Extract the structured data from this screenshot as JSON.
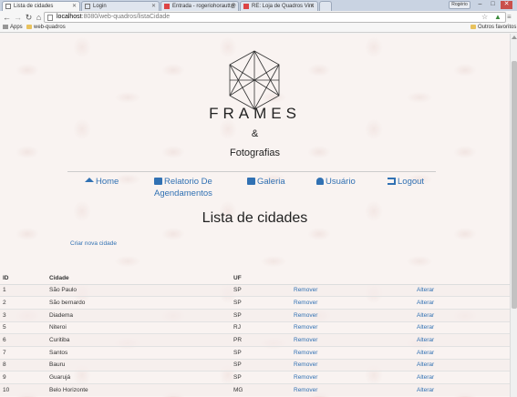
{
  "browser": {
    "tabs": [
      {
        "title": "Lista de cidades",
        "active": true
      },
      {
        "title": "Login",
        "active": false
      },
      {
        "title": "Entrada - rogeriohorautt@",
        "active": false
      },
      {
        "title": "RE: Loja de Quadros Vint",
        "active": false
      }
    ],
    "profile_label": "Rogério",
    "url_host": "localhost",
    "url_rest": ":8080/web-quadros/listaCidade",
    "bookmarks": {
      "apps": "Apps",
      "folder": "web-quadros",
      "other": "Outros favoritos"
    }
  },
  "page": {
    "brand_title": "FRAMES",
    "brand_amp": "&",
    "brand_sub": "Fotografias",
    "nav": {
      "home": "Home",
      "relatorio_line1": "Relatorio De",
      "relatorio_line2": "Agendamentos",
      "galeria": "Galeria",
      "usuario": "Usuário",
      "logout": "Logout"
    },
    "heading": "Lista de cidades",
    "create_link": "Criar nova cidade",
    "table": {
      "headers": {
        "id": "ID",
        "city": "Cidade",
        "uf": "UF",
        "remove": "",
        "edit": ""
      },
      "action_remove": "Remover",
      "action_edit": "Alterar",
      "rows": [
        {
          "id": "1",
          "city": "São Paulo",
          "uf": "SP"
        },
        {
          "id": "2",
          "city": "São bernardo",
          "uf": "SP"
        },
        {
          "id": "3",
          "city": "Diadema",
          "uf": "SP"
        },
        {
          "id": "5",
          "city": "Niteroi",
          "uf": "RJ"
        },
        {
          "id": "6",
          "city": "Curitiba",
          "uf": "PR"
        },
        {
          "id": "7",
          "city": "Santos",
          "uf": "SP"
        },
        {
          "id": "8",
          "city": "Bauru",
          "uf": "SP"
        },
        {
          "id": "9",
          "city": "Guarujá",
          "uf": "SP"
        },
        {
          "id": "10",
          "city": "Belo Horizonte",
          "uf": "MG"
        }
      ]
    }
  },
  "colors": {
    "link": "#3171b3",
    "text": "#222222",
    "background": "#f9f3f1"
  }
}
